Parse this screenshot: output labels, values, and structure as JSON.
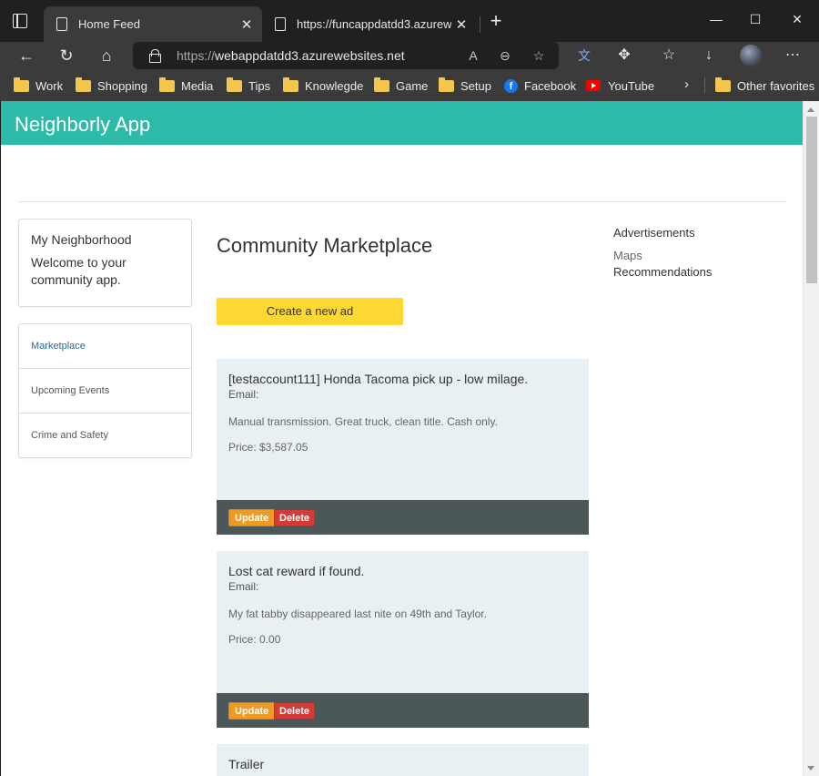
{
  "browser": {
    "tabs": [
      {
        "title": "Home Feed",
        "close": "✕"
      },
      {
        "title": "https://funcappdatdd3.azureweb",
        "close": "✕"
      }
    ],
    "new_tab": "+",
    "window_controls": {
      "minimize": "—",
      "maximize": "☐",
      "close": "✕"
    },
    "address": {
      "protocol": "https://",
      "host": "webappdatdd3.azurewebsites.net"
    },
    "favorites": [
      {
        "label": "Work",
        "icon": "folder-icon"
      },
      {
        "label": "Shopping",
        "icon": "folder-icon"
      },
      {
        "label": "Media",
        "icon": "folder-icon"
      },
      {
        "label": "Tips",
        "icon": "folder-icon"
      },
      {
        "label": "Knowlegde",
        "icon": "folder-icon"
      },
      {
        "label": "Game",
        "icon": "folder-icon"
      },
      {
        "label": "Setup",
        "icon": "folder-icon"
      },
      {
        "label": "Facebook",
        "icon": "facebook-icon"
      },
      {
        "label": "YouTube",
        "icon": "youtube-icon"
      }
    ],
    "other_favorites": "Other favorites"
  },
  "app": {
    "name": "Neighborly App",
    "accent_color": "#2ebaa8",
    "neighborhood": {
      "title": "My Neighborhood",
      "welcome": "Welcome to your community app."
    },
    "nav": [
      "Marketplace",
      "Upcoming Events",
      "Crime and Safety"
    ],
    "marketplace": {
      "title": "Community Marketplace",
      "create_label": "Create a new ad",
      "update_label": "Update",
      "delete_label": "Delete",
      "ads": [
        {
          "title": "[testaccount111] Honda Tacoma pick up - low milage.",
          "email": "Email:",
          "description": "Manual transmission. Great truck, clean title. Cash only.",
          "price": "Price: $3,587.05"
        },
        {
          "title": "Lost cat reward if found.",
          "email": "Email:",
          "description": "My fat tabby disappeared last nite on 49th and Taylor.",
          "price": "Price: 0.00"
        },
        {
          "title": "Trailer"
        }
      ]
    },
    "sidebar_right": [
      "Advertisements",
      "Maps",
      "Recommendations"
    ]
  }
}
